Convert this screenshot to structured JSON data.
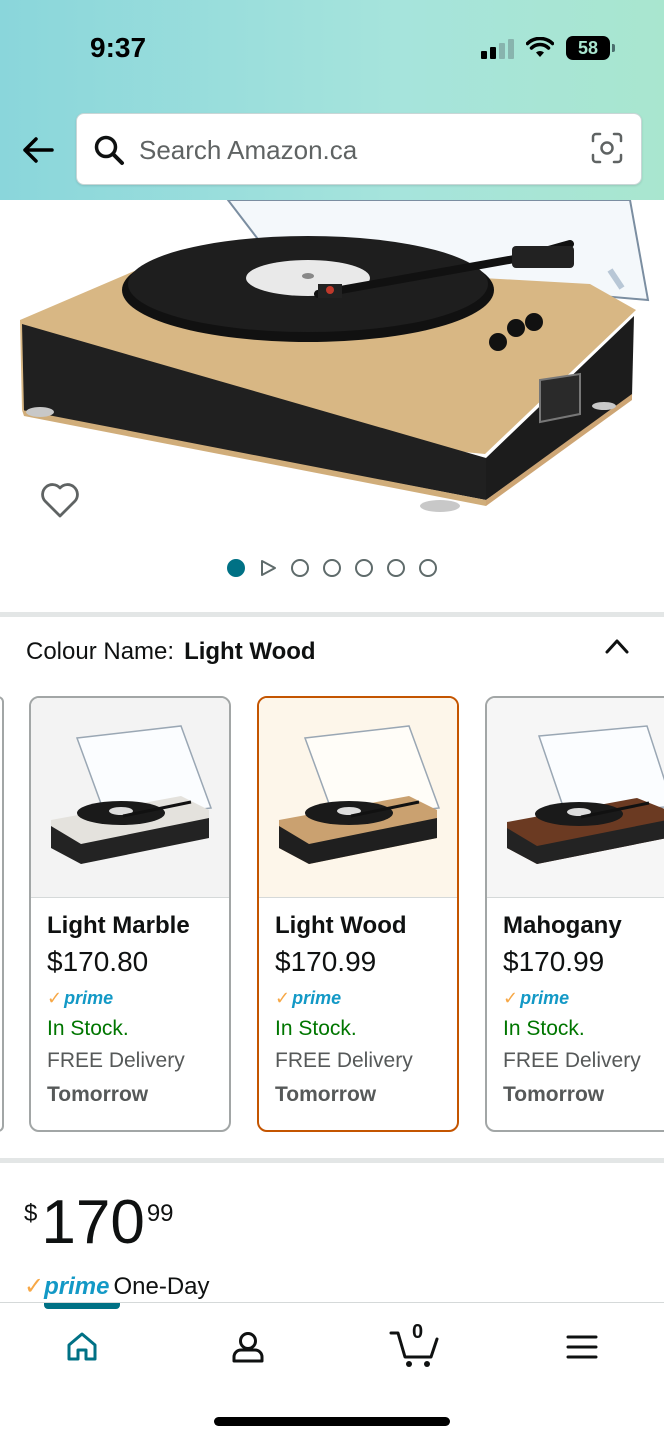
{
  "status_bar": {
    "time": "9:37",
    "battery": "58"
  },
  "header": {
    "search": {
      "placeholder": "Search Amazon.ca"
    }
  },
  "gallery": {
    "dot_count": 7,
    "active_index": 0
  },
  "colour": {
    "label": "Colour Name:",
    "selected": "Light Wood",
    "options": [
      {
        "name": "Light Marble",
        "price": "$170.80",
        "prime": "prime",
        "stock": "In Stock.",
        "delivery": "FREE Delivery",
        "day": "Tomorrow",
        "selected": false,
        "base": "#eeeeee"
      },
      {
        "name": "Light Wood",
        "price": "$170.99",
        "prime": "prime",
        "stock": "In Stock.",
        "delivery": "FREE Delivery",
        "day": "Tomorrow",
        "selected": true,
        "base": "#c9a06b"
      },
      {
        "name": "Mahogany",
        "price": "$170.99",
        "prime": "prime",
        "stock": "In Stock.",
        "delivery": "FREE Delivery",
        "day": "Tomorrow",
        "selected": false,
        "base": "#6b3a22"
      }
    ]
  },
  "price": {
    "symbol": "$",
    "whole": "170",
    "fraction": "99"
  },
  "prime_delivery": {
    "check": "✓",
    "word": "prime",
    "text": "One-Day"
  },
  "bottom_nav": {
    "items": [
      "home",
      "account",
      "cart",
      "menu"
    ],
    "cart_count": "0",
    "active": "home"
  },
  "colors": {
    "accent": "#007185",
    "selected_border": "#c45500",
    "in_stock": "#007600",
    "prime_blue": "#1399c6"
  }
}
